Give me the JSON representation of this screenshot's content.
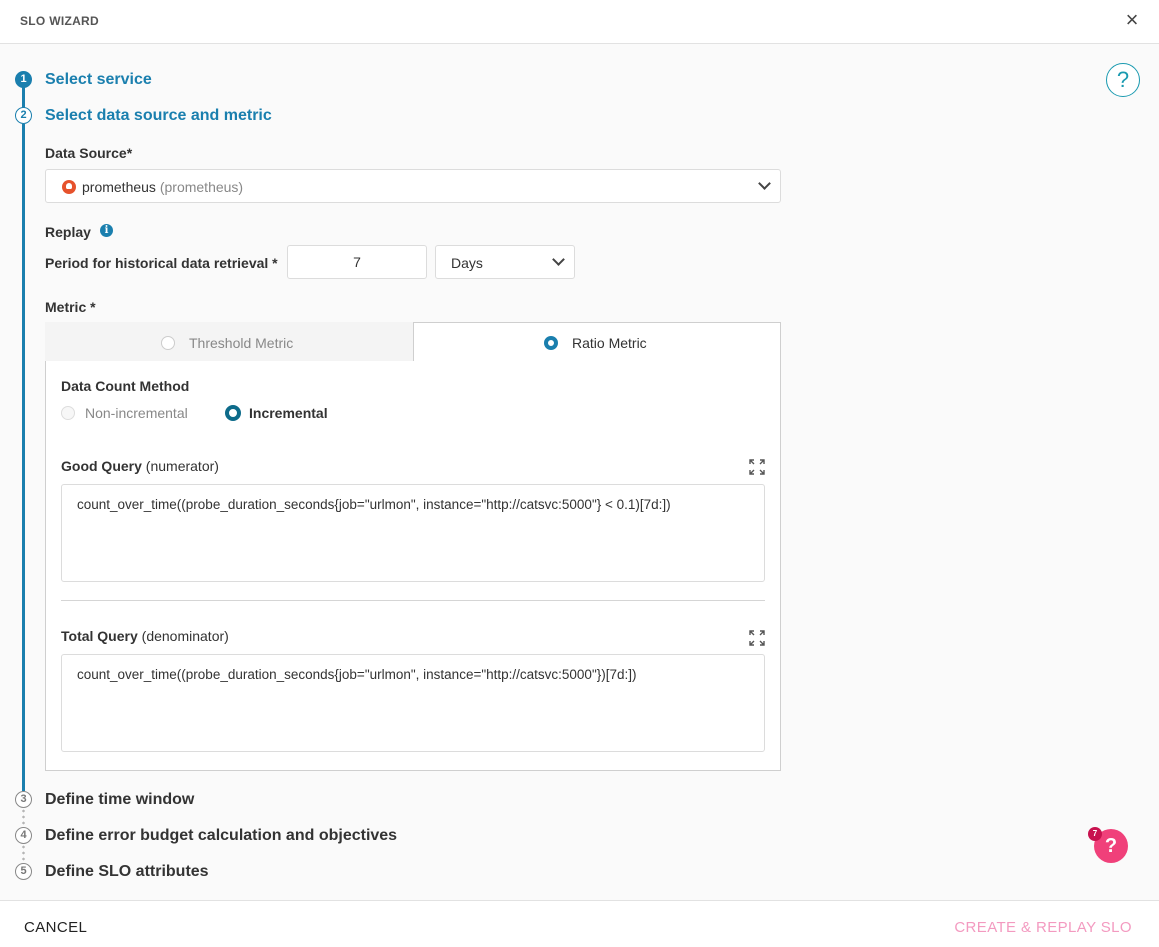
{
  "header": {
    "title": "SLO WIZARD",
    "close_label": "×"
  },
  "steps": [
    {
      "number": "1",
      "label": "Select service"
    },
    {
      "number": "2",
      "label": "Select data source and metric"
    },
    {
      "number": "3",
      "label": "Define time window"
    },
    {
      "number": "4",
      "label": "Define error budget calculation and objectives"
    },
    {
      "number": "5",
      "label": "Define SLO attributes"
    }
  ],
  "help_label": "?",
  "data_source": {
    "label": "Data Source*",
    "value": "prometheus",
    "value_sub": "(prometheus)"
  },
  "replay": {
    "label": "Replay",
    "info_label": "i",
    "period_label": "Period for historical data retrieval *",
    "period_value": "7",
    "unit_value": "Days"
  },
  "metric": {
    "label": "Metric *",
    "tabs": [
      {
        "label": "Threshold Metric",
        "selected": false
      },
      {
        "label": "Ratio Metric",
        "selected": true
      }
    ],
    "count_method": {
      "label": "Data Count Method",
      "options": [
        {
          "label": "Non-incremental",
          "selected": false
        },
        {
          "label": "Incremental",
          "selected": true
        }
      ]
    },
    "good_query": {
      "label": "Good Query",
      "sub": "(numerator)",
      "value": "count_over_time((probe_duration_seconds{job=\"urlmon\", instance=\"http://catsvc:5000\"} < 0.1)[7d:])"
    },
    "total_query": {
      "label": "Total Query",
      "sub": "(denominator)",
      "value": "count_over_time((probe_duration_seconds{job=\"urlmon\", instance=\"http://catsvc:5000\"})[7d:])"
    }
  },
  "footer": {
    "cancel": "CANCEL",
    "create": "CREATE & REPLAY SLO"
  },
  "float_help": {
    "label": "?",
    "badge": "7"
  },
  "colors": {
    "accent": "#1a7fae",
    "create_disabled": "#f39ac0",
    "float_help": "#f0407a"
  }
}
